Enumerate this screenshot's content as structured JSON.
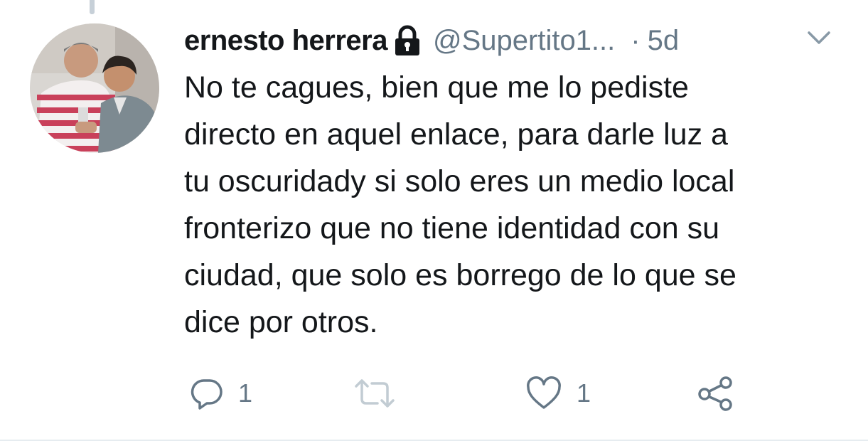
{
  "tweet": {
    "display_name": "ernesto herrera",
    "handle": "@Supertito1...",
    "separator": "·",
    "time": "5d",
    "body_lines": [
      "No te cagues, bien que me lo pediste",
      "directo en aquel enlace, para darle luz a",
      "tu oscuridady si solo eres un medio local",
      "fronterizo que no tiene identidad con su",
      "ciudad, que solo es borrego de lo que se",
      "dice por otros."
    ],
    "protected": true,
    "actions": {
      "reply_count": "1",
      "retweet_count": "",
      "like_count": "1"
    }
  },
  "icons": {
    "lock": "lock-icon",
    "caret": "chevron-down-icon",
    "reply": "reply-icon",
    "retweet": "retweet-icon",
    "like": "heart-icon",
    "share": "share-icon"
  },
  "colors": {
    "text_primary": "#14171a",
    "text_secondary": "#657786",
    "icon": "#657786",
    "thread_line": "#c7d0d8"
  }
}
